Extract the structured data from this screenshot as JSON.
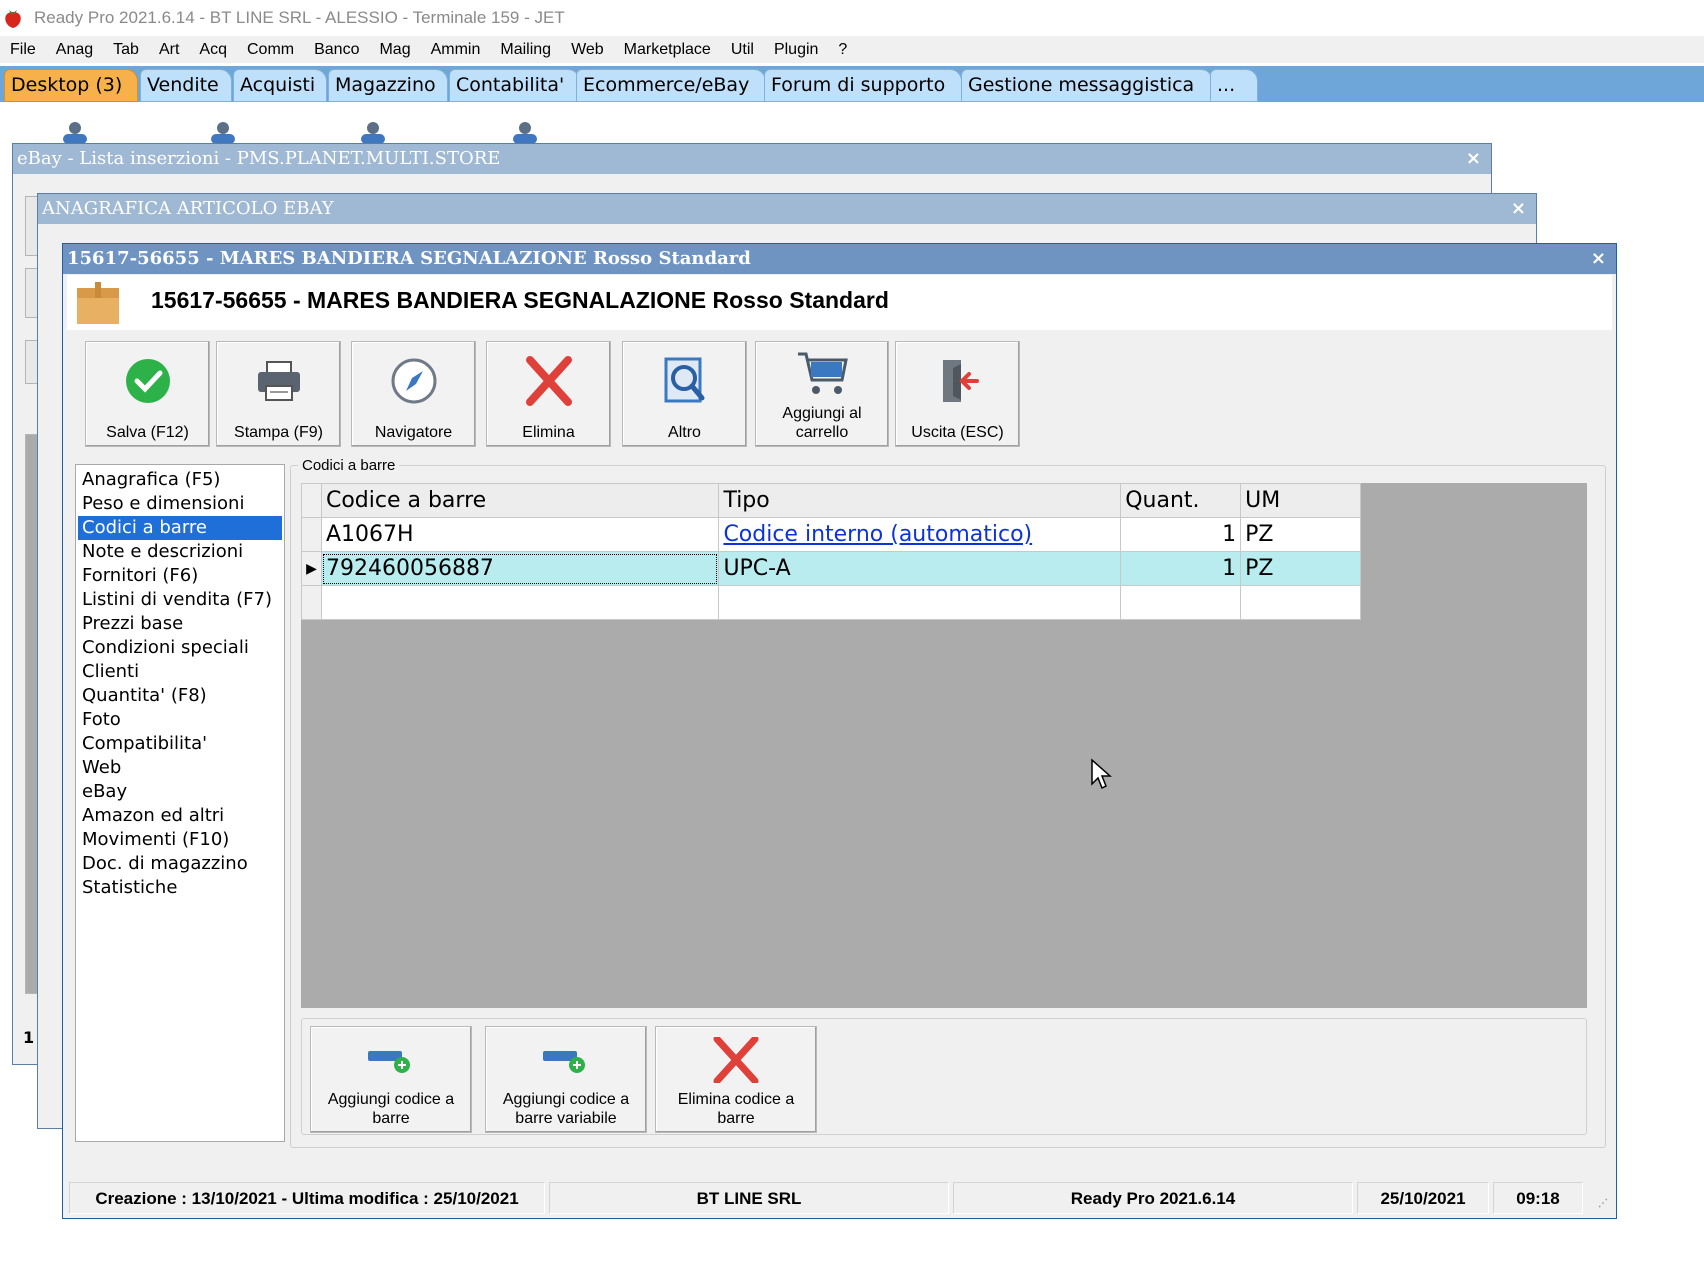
{
  "app": {
    "title": "Ready Pro 2021.6.14 - BT LINE SRL - ALESSIO - Terminale 159 - JET"
  },
  "menu": [
    "File",
    "Anag",
    "Tab",
    "Art",
    "Acq",
    "Comm",
    "Banco",
    "Mag",
    "Ammin",
    "Mailing",
    "Web",
    "Marketplace",
    "Util",
    "Plugin",
    "?"
  ],
  "tabs": [
    {
      "label": "Desktop (3)",
      "active": true
    },
    {
      "label": "Vendite"
    },
    {
      "label": "Acquisti"
    },
    {
      "label": "Magazzino"
    },
    {
      "label": "Contabilita'"
    },
    {
      "label": "Ecommerce/eBay"
    },
    {
      "label": "Forum di supporto"
    },
    {
      "label": "Gestione messaggistica"
    },
    {
      "label": "..."
    }
  ],
  "windows": {
    "ebay_list": {
      "title": "eBay - Lista inserzioni - PMS.PLANET.MULTI.STORE",
      "close": "×",
      "fragment_text": "1"
    },
    "anagrafica": {
      "title": "ANAGRAFICA ARTICOLO EBAY",
      "close": "×"
    },
    "main": {
      "title": "15617-56655 - MARES BANDIERA SEGNALAZIONE Rosso Standard",
      "close": "×",
      "header": "15617-56655 - MARES BANDIERA SEGNALAZIONE Rosso Standard"
    }
  },
  "toolbar": {
    "save": "Salva (F12)",
    "print": "Stampa (F9)",
    "navigator": "Navigatore",
    "delete": "Elimina",
    "other": "Altro",
    "add_cart": "Aggiungi al carrello",
    "exit": "Uscita (ESC)"
  },
  "nav": {
    "items": [
      "Anagrafica (F5)",
      "Peso e dimensioni",
      "Codici a barre",
      "Note e descrizioni",
      "Fornitori (F6)",
      "Listini di vendita (F7)",
      "Prezzi base",
      "Condizioni speciali",
      "Clienti",
      "Quantita' (F8)",
      "Foto",
      "Compatibilita'",
      "Web",
      "eBay",
      "Amazon ed altri",
      "Movimenti (F10)",
      "Doc. di magazzino",
      "Statistiche"
    ],
    "selected_index": 2
  },
  "barcodes": {
    "group_title": "Codici a barre",
    "columns": [
      "Codice a barre",
      "Tipo",
      "Quant.",
      "UM"
    ],
    "rows": [
      {
        "code": "A1067H",
        "type": "Codice interno (automatico)",
        "qty": "1",
        "um": "PZ"
      },
      {
        "code": "792460056887",
        "type": "UPC-A",
        "qty": "1",
        "um": "PZ"
      }
    ],
    "buttons": {
      "add": "Aggiungi codice a barre",
      "add_variable": "Aggiungi codice a barre variabile",
      "delete": "Elimina codice a barre"
    }
  },
  "status": {
    "dates": "Creazione : 13/10/2021 - Ultima modifica : 25/10/2021",
    "company": "BT LINE SRL",
    "version": "Ready Pro 2021.6.14",
    "date": "25/10/2021",
    "time": "09:18",
    "grip": "⋰"
  },
  "colors": {
    "tabstrip": "#6ea6d9",
    "active_tab": "#f7b14a",
    "selection": "#1f6fd8",
    "current_row": "#b8ecef",
    "save_green": "#2db24a",
    "delete_red": "#e0403a",
    "icon_blue": "#3a78c2"
  }
}
